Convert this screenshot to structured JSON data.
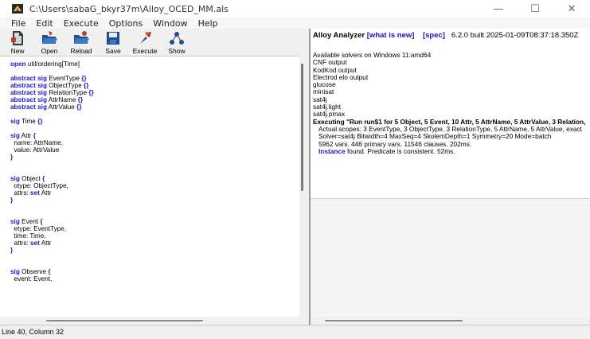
{
  "window": {
    "title": "C:\\Users\\sabaG_bkyr37m\\Alloy_OCED_MM.als",
    "controls": {
      "minimize": "—",
      "maximize": "☐",
      "close": "✕"
    }
  },
  "menu": [
    "File",
    "Edit",
    "Execute",
    "Options",
    "Window",
    "Help"
  ],
  "toolbar": [
    {
      "label": "New",
      "icon": "new-file-icon"
    },
    {
      "label": "Open",
      "icon": "open-folder-icon"
    },
    {
      "label": "Reload",
      "icon": "reload-folder-icon"
    },
    {
      "label": "Save",
      "icon": "floppy-save-icon"
    },
    {
      "label": "Execute",
      "icon": "execute-icon"
    },
    {
      "label": "Show",
      "icon": "show-tree-icon"
    }
  ],
  "editor": {
    "lines": [
      [
        {
          "t": "open",
          "k": true
        },
        {
          "t": " util/ordering[Time]"
        }
      ],
      [],
      [
        {
          "t": "abstract sig",
          "k": true
        },
        {
          "t": " EventType "
        },
        {
          "t": "{}",
          "k": true
        }
      ],
      [
        {
          "t": "abstract sig",
          "k": true
        },
        {
          "t": " ObjectType "
        },
        {
          "t": "{}",
          "k": true
        }
      ],
      [
        {
          "t": "abstract sig",
          "k": true
        },
        {
          "t": " RelationType "
        },
        {
          "t": "{}",
          "k": true
        }
      ],
      [
        {
          "t": "abstract sig",
          "k": true
        },
        {
          "t": " AttrName "
        },
        {
          "t": "{}",
          "k": true
        }
      ],
      [
        {
          "t": "abstract sig",
          "k": true
        },
        {
          "t": " AttrValue "
        },
        {
          "t": "{}",
          "k": true
        }
      ],
      [],
      [
        {
          "t": "sig",
          "k": true
        },
        {
          "t": " Time "
        },
        {
          "t": "{}",
          "k": true
        }
      ],
      [],
      [
        {
          "t": "sig",
          "k": true
        },
        {
          "t": " Attr "
        },
        {
          "t": "{",
          "k": true
        }
      ],
      [
        {
          "t": "  name: AttrName,"
        }
      ],
      [
        {
          "t": "  value: AttrValue"
        }
      ],
      [
        {
          "t": "}",
          "k": true
        }
      ],
      [],
      [],
      [
        {
          "t": "sig",
          "k": true
        },
        {
          "t": " Object "
        },
        {
          "t": "{",
          "k": true
        }
      ],
      [
        {
          "t": "  otype: ObjectType,"
        }
      ],
      [
        {
          "t": "  attrs: "
        },
        {
          "t": "set",
          "k": true
        },
        {
          "t": " Attr"
        }
      ],
      [
        {
          "t": "}",
          "k": true
        }
      ],
      [],
      [],
      [
        {
          "t": "sig",
          "k": true
        },
        {
          "t": " Event "
        },
        {
          "t": "{",
          "k": true
        }
      ],
      [
        {
          "t": "  etype: EventType,"
        }
      ],
      [
        {
          "t": "  time: Time,"
        }
      ],
      [
        {
          "t": "  attrs: "
        },
        {
          "t": "set",
          "k": true
        },
        {
          "t": " Attr"
        }
      ],
      [
        {
          "t": "}",
          "k": true
        }
      ],
      [],
      [],
      [
        {
          "t": "sig",
          "k": true
        },
        {
          "t": " Observe "
        },
        {
          "t": "{",
          "k": true
        }
      ],
      [
        {
          "t": "  event: Event,"
        }
      ]
    ]
  },
  "output": {
    "header_app": "Alloy Analyzer",
    "header_whatsnew": "[what is new]",
    "header_spec": "[spec]",
    "header_version": "6.2.0 built 2025-01-09T08:37:18.350Z",
    "solvers_intro": "Available solvers on Windows 11:amd64",
    "solvers": [
      "CNF output",
      "KodKod output",
      "Electrod elo output",
      "glucose",
      "minisat",
      "sat4j",
      "sat4j.light",
      "sat4j.pmax"
    ],
    "executing": "Executing \"Run run$1 for 5 Object, 5 Event, 10 Attr, 5 AttrName, 5 AttrValue, 3 Relation,",
    "scopes": "Actual scopes: 3 EventType, 3 ObjectType, 3 RelationType, 5 AttrName, 5 AttrValue, exact",
    "solver_line": "Solver=sat4j Bitwidth=4 MaxSeq=4 SkolemDepth=1 Symmetry=20 Mode=batch",
    "stats": "5962 vars. 446 primary vars. 11546 clauses. 202ms.",
    "instance_link": "Instance",
    "instance_rest": " found. Predicate is consistent. 52ms."
  },
  "status": "Line 40, Column 32",
  "colors": {
    "keyword": "#1d15c9",
    "background": "#f0f0f0"
  }
}
